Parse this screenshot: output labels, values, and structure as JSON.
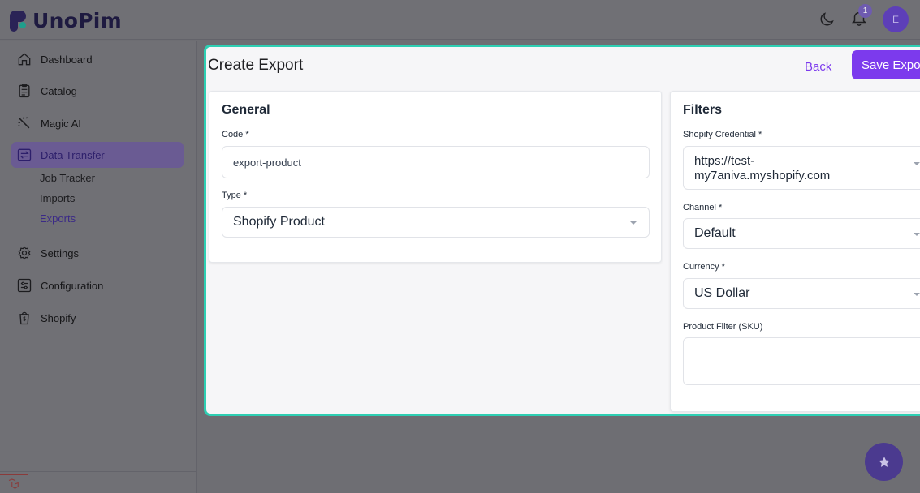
{
  "app": {
    "name": "UnoPim"
  },
  "header": {
    "notification_count": "1",
    "avatar_initial": "E",
    "icons": [
      "moon-icon",
      "bell-icon"
    ]
  },
  "sidebar": {
    "items": [
      {
        "label": "Dashboard",
        "icon": "home-icon"
      },
      {
        "label": "Catalog",
        "icon": "clipboard-icon"
      },
      {
        "label": "Magic AI",
        "icon": "magic-wand-icon"
      },
      {
        "label": "Data Transfer",
        "icon": "transfer-icon",
        "active": true
      },
      {
        "label": "Settings",
        "icon": "gear-icon"
      },
      {
        "label": "Configuration",
        "icon": "sliders-icon"
      },
      {
        "label": "Shopify",
        "icon": "shopping-bag-icon"
      }
    ],
    "sub_items": [
      {
        "label": "Job Tracker"
      },
      {
        "label": "Imports"
      },
      {
        "label": "Exports",
        "active": true
      }
    ]
  },
  "page": {
    "title": "Create Export",
    "back_label": "Back",
    "save_label": "Save Export"
  },
  "general": {
    "title": "General",
    "code_label": "Code *",
    "code_value": "export-product",
    "type_label": "Type *",
    "type_value": "Shopify Product"
  },
  "filters": {
    "title": "Filters",
    "credential_label": "Shopify Credential *",
    "credential_value_line1": "https://test-",
    "credential_value_line2": "my7aniva.myshopify.com",
    "channel_label": "Channel *",
    "channel_value": "Default",
    "currency_label": "Currency *",
    "currency_value": "US Dollar",
    "sku_label": "Product Filter (SKU)",
    "sku_value": ""
  },
  "colors": {
    "accent": "#7c3aed",
    "highlight_border": "#2ecfb3",
    "overlay": "#6e6e73"
  }
}
